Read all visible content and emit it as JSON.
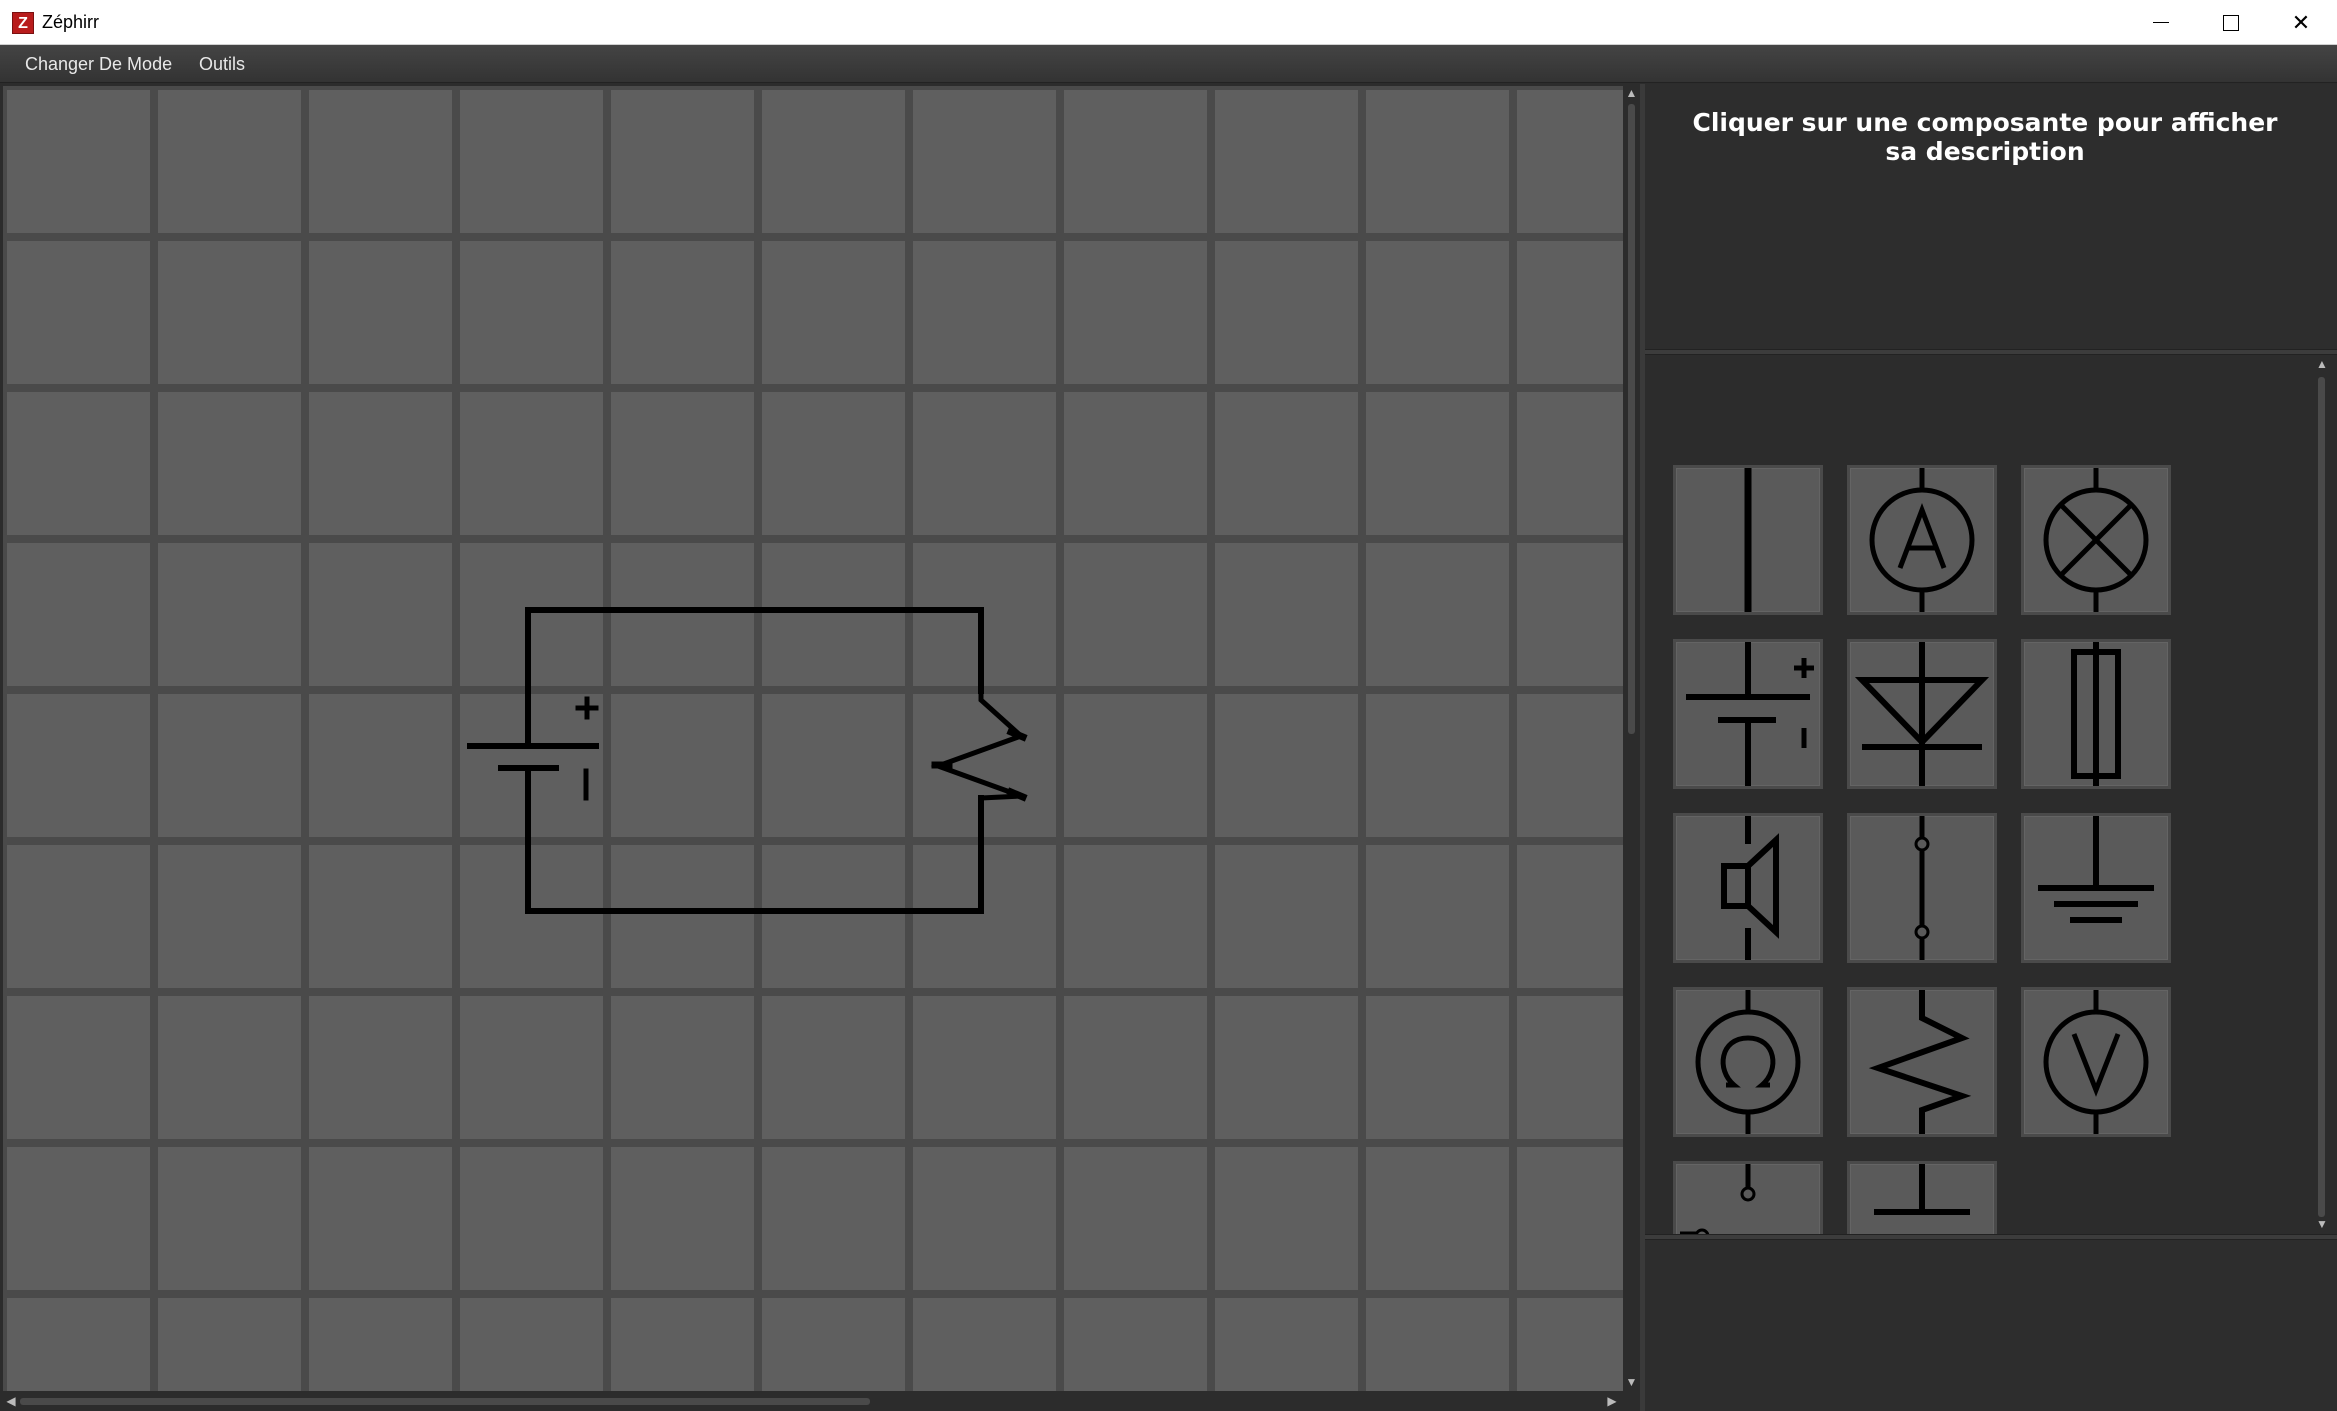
{
  "window": {
    "title": "Zéphirr",
    "logo_letter": "Z",
    "controls": {
      "minimize": "minimize",
      "maximize": "maximize",
      "close": "✕"
    }
  },
  "menu": {
    "items": [
      {
        "label": "Changer De Mode"
      },
      {
        "label": "Outils"
      }
    ]
  },
  "description_panel": {
    "text": "Cliquer sur une composante pour afficher sa description"
  },
  "palette": {
    "components": [
      {
        "icon": "wire-icon"
      },
      {
        "icon": "ammeter-icon"
      },
      {
        "icon": "lamp-icon"
      },
      {
        "icon": "battery-icon"
      },
      {
        "icon": "diode-icon"
      },
      {
        "icon": "fuse-icon"
      },
      {
        "icon": "speaker-icon"
      },
      {
        "icon": "connector-icon"
      },
      {
        "icon": "ground-icon"
      },
      {
        "icon": "ohmmeter-icon"
      },
      {
        "icon": "resistor-icon"
      },
      {
        "icon": "voltmeter-icon"
      },
      {
        "icon": "switch-icon"
      },
      {
        "icon": "capacitor-icon"
      }
    ]
  },
  "circuit": {
    "components": [
      "battery-icon",
      "resistor-icon"
    ]
  },
  "colors": {
    "grid_cell": "#5f5f5f",
    "grid_line": "#4a4a4a",
    "wire": "#000000",
    "panel_bg": "#2c2c2c",
    "text": "#ffffff"
  }
}
